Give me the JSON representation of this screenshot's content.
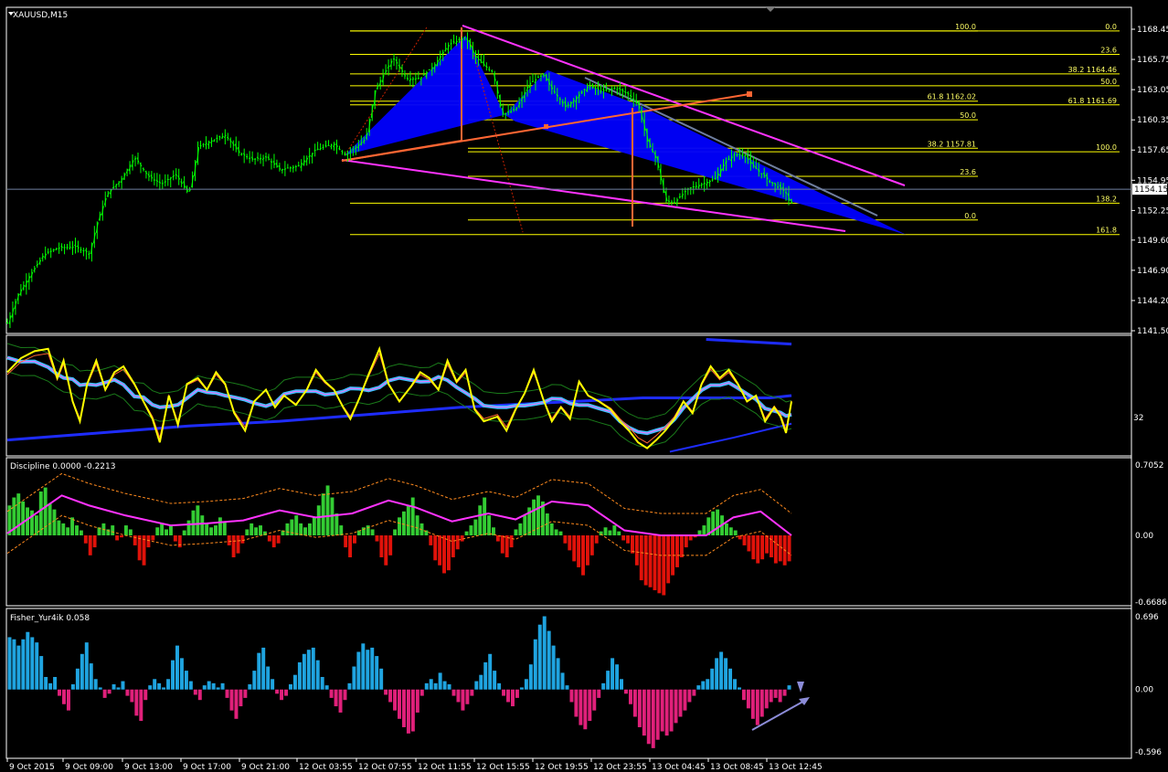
{
  "window": {
    "symbol_title": "XAUUSD,M15"
  },
  "colors": {
    "background": "#000000",
    "frame": "#ffffff",
    "candles": "#00ff00",
    "fib_levels": "#ffff00",
    "channel": "#ff33ff",
    "pattern_fill": "#0000ff",
    "trend_line": "#ff6633",
    "price_line": "#6f7fa0",
    "rsi": "#ffff00",
    "band": "#1e2cff",
    "histogram_up": "#33cc33",
    "histogram_down": "#e0120a",
    "signal": "#ff33ff",
    "fisher_up": "#1fa4e0",
    "fisher_down": "#e0207a",
    "arrow": "#8c8cd8"
  },
  "chart_data": [
    {
      "type": "candlestick",
      "panel": "main",
      "title": "XAUUSD,M15",
      "ylim": [
        1141.5,
        1168.45
      ],
      "y_ticks": [
        "1168.45",
        "1165.75",
        "1163.05",
        "1160.35",
        "1157.65",
        "1154.95",
        "1152.25",
        "1149.60",
        "1146.90",
        "1144.20",
        "1141.50"
      ],
      "current_price": "1154.15",
      "close_path": [
        [
          0,
          1142.2
        ],
        [
          12,
          1144.8
        ],
        [
          25,
          1146.5
        ],
        [
          40,
          1148.3
        ],
        [
          55,
          1148.9
        ],
        [
          75,
          1149.0
        ],
        [
          90,
          1148.4
        ],
        [
          100,
          1151.5
        ],
        [
          110,
          1153.8
        ],
        [
          125,
          1155.0
        ],
        [
          140,
          1157.0
        ],
        [
          155,
          1155.3
        ],
        [
          170,
          1154.6
        ],
        [
          185,
          1155.5
        ],
        [
          200,
          1153.7
        ],
        [
          210,
          1157.9
        ],
        [
          225,
          1158.5
        ],
        [
          240,
          1159.0
        ],
        [
          255,
          1157.4
        ],
        [
          270,
          1156.8
        ],
        [
          285,
          1157.0
        ],
        [
          300,
          1155.9
        ],
        [
          320,
          1156.2
        ],
        [
          340,
          1157.7
        ],
        [
          360,
          1158.2
        ],
        [
          372,
          1157.2
        ],
        [
          385,
          1158.0
        ],
        [
          395,
          1158.7
        ],
        [
          405,
          1163.0
        ],
        [
          415,
          1164.5
        ],
        [
          425,
          1165.9
        ],
        [
          440,
          1164.0
        ],
        [
          455,
          1164.1
        ],
        [
          470,
          1165.2
        ],
        [
          485,
          1167.0
        ],
        [
          495,
          1167.4
        ],
        [
          505,
          1167.7
        ],
        [
          515,
          1166.0
        ],
        [
          525,
          1165.2
        ],
        [
          535,
          1164.6
        ],
        [
          545,
          1160.8
        ],
        [
          560,
          1161.3
        ],
        [
          575,
          1163.6
        ],
        [
          590,
          1164.4
        ],
        [
          600,
          1163.1
        ],
        [
          615,
          1161.5
        ],
        [
          625,
          1162.2
        ],
        [
          640,
          1163.4
        ],
        [
          655,
          1162.9
        ],
        [
          670,
          1163.2
        ],
        [
          685,
          1162.6
        ],
        [
          695,
          1161.7
        ],
        [
          705,
          1158.4
        ],
        [
          715,
          1156.8
        ],
        [
          725,
          1153.1
        ],
        [
          735,
          1153.0
        ],
        [
          750,
          1154.2
        ],
        [
          765,
          1154.6
        ],
        [
          780,
          1155.1
        ],
        [
          790,
          1156.5
        ],
        [
          800,
          1157.2
        ],
        [
          812,
          1157.3
        ],
        [
          820,
          1156.3
        ],
        [
          830,
          1155.6
        ],
        [
          840,
          1154.8
        ],
        [
          850,
          1154.3
        ],
        [
          858,
          1153.8
        ],
        [
          862,
          1152.9
        ]
      ],
      "fibonacci": {
        "set_a": [
          {
            "label": "100.0",
            "price": 1168.3
          },
          {
            "label": "23.6",
            "price": 1166.2
          },
          {
            "label": "38.2 1164.46",
            "price": 1164.46
          },
          {
            "label": "50.0",
            "price": 1163.4
          },
          {
            "label": "61.8 1162.02",
            "price": 1162.02
          },
          {
            "label": "0.0",
            "price": 1168.3
          },
          {
            "label": "61.8 1161.69",
            "price": 1161.69
          },
          {
            "label": "138.2",
            "price": 1152.9
          },
          {
            "label": "161.8",
            "price": 1150.1
          }
        ],
        "set_b": [
          {
            "label": "50.0",
            "price": 1160.35
          },
          {
            "label": "38.2 1157.81",
            "price": 1157.81
          },
          {
            "label": "100.0",
            "price": 1157.5
          },
          {
            "label": "23.6",
            "price": 1155.3
          },
          {
            "label": "0.0",
            "price": 1151.4
          }
        ]
      }
    },
    {
      "type": "line",
      "panel": "rsi",
      "y_tick": "32",
      "series_yellow": [
        [
          0,
          0.3
        ],
        [
          15,
          0.18
        ],
        [
          30,
          0.12
        ],
        [
          45,
          0.1
        ],
        [
          55,
          0.35
        ],
        [
          62,
          0.2
        ],
        [
          72,
          0.55
        ],
        [
          80,
          0.72
        ],
        [
          88,
          0.4
        ],
        [
          98,
          0.2
        ],
        [
          108,
          0.45
        ],
        [
          118,
          0.3
        ],
        [
          128,
          0.25
        ],
        [
          140,
          0.4
        ],
        [
          150,
          0.55
        ],
        [
          160,
          0.7
        ],
        [
          168,
          0.9
        ],
        [
          178,
          0.5
        ],
        [
          188,
          0.75
        ],
        [
          198,
          0.4
        ],
        [
          210,
          0.35
        ],
        [
          220,
          0.45
        ],
        [
          230,
          0.3
        ],
        [
          240,
          0.4
        ],
        [
          250,
          0.65
        ],
        [
          262,
          0.8
        ],
        [
          272,
          0.55
        ],
        [
          285,
          0.45
        ],
        [
          295,
          0.6
        ],
        [
          305,
          0.5
        ],
        [
          318,
          0.58
        ],
        [
          330,
          0.45
        ],
        [
          340,
          0.28
        ],
        [
          350,
          0.38
        ],
        [
          360,
          0.45
        ],
        [
          370,
          0.6
        ],
        [
          378,
          0.7
        ],
        [
          388,
          0.52
        ],
        [
          398,
          0.32
        ],
        [
          410,
          0.1
        ],
        [
          420,
          0.4
        ],
        [
          432,
          0.55
        ],
        [
          445,
          0.42
        ],
        [
          455,
          0.3
        ],
        [
          465,
          0.35
        ],
        [
          475,
          0.45
        ],
        [
          485,
          0.2
        ],
        [
          495,
          0.38
        ],
        [
          505,
          0.28
        ],
        [
          515,
          0.62
        ],
        [
          525,
          0.72
        ],
        [
          540,
          0.68
        ],
        [
          550,
          0.8
        ],
        [
          560,
          0.62
        ],
        [
          570,
          0.48
        ],
        [
          580,
          0.28
        ],
        [
          590,
          0.52
        ],
        [
          600,
          0.72
        ],
        [
          610,
          0.6
        ],
        [
          620,
          0.7
        ],
        [
          630,
          0.38
        ],
        [
          640,
          0.5
        ],
        [
          652,
          0.55
        ],
        [
          665,
          0.62
        ],
        [
          675,
          0.72
        ],
        [
          685,
          0.8
        ],
        [
          695,
          0.9
        ],
        [
          705,
          0.95
        ],
        [
          715,
          0.88
        ],
        [
          725,
          0.8
        ],
        [
          735,
          0.7
        ],
        [
          745,
          0.55
        ],
        [
          755,
          0.65
        ],
        [
          765,
          0.4
        ],
        [
          775,
          0.25
        ],
        [
          785,
          0.35
        ],
        [
          795,
          0.28
        ],
        [
          805,
          0.4
        ],
        [
          815,
          0.55
        ],
        [
          825,
          0.5
        ],
        [
          835,
          0.72
        ],
        [
          845,
          0.6
        ],
        [
          852,
          0.68
        ],
        [
          858,
          0.82
        ],
        [
          864,
          0.55
        ]
      ],
      "series_band": [
        [
          0,
          0.88
        ],
        [
          100,
          0.82
        ],
        [
          200,
          0.76
        ],
        [
          300,
          0.72
        ],
        [
          400,
          0.66
        ],
        [
          500,
          0.6
        ],
        [
          600,
          0.56
        ],
        [
          700,
          0.52
        ],
        [
          760,
          0.52
        ],
        [
          800,
          0.52
        ],
        [
          840,
          0.52
        ],
        [
          864,
          0.5
        ]
      ],
      "series_band_top": [
        [
          770,
          0.02
        ],
        [
          864,
          0.06
        ]
      ],
      "series_band_bottom": [
        [
          730,
          0.98
        ],
        [
          800,
          0.86
        ],
        [
          864,
          0.74
        ]
      ]
    },
    {
      "type": "bar",
      "panel": "discipline",
      "title": "Discipline 0.0000 -0.2213",
      "ylim": [
        -0.6686,
        0.7052
      ],
      "y_ticks": [
        "0.7052",
        "0.00",
        "-0.6686"
      ],
      "values": [
        0.3,
        0.38,
        0.42,
        0.34,
        0.28,
        0.25,
        0.2,
        0.44,
        0.48,
        0.32,
        0.26,
        0.15,
        0.12,
        0.08,
        0.18,
        0.1,
        0.05,
        -0.08,
        -0.2,
        -0.12,
        0.08,
        0.12,
        0.06,
        0.1,
        -0.05,
        -0.02,
        0.1,
        0.06,
        -0.1,
        -0.25,
        -0.3,
        -0.12,
        -0.05,
        0.08,
        0.12,
        0.06,
        0.1,
        -0.06,
        -0.12,
        0.05,
        0.15,
        0.25,
        0.3,
        0.2,
        0.12,
        0.08,
        0.1,
        0.18,
        0.14,
        -0.1,
        -0.22,
        -0.18,
        -0.08,
        0.06,
        0.12,
        0.08,
        0.1,
        0.04,
        -0.06,
        -0.12,
        -0.08,
        0.05,
        0.12,
        0.16,
        0.2,
        0.12,
        0.08,
        0.12,
        0.18,
        0.3,
        0.42,
        0.5,
        0.38,
        0.22,
        0.1,
        -0.12,
        -0.22,
        -0.08,
        0.05,
        0.08,
        0.1,
        0.06,
        -0.06,
        -0.22,
        -0.3,
        -0.2,
        0.06,
        0.18,
        0.24,
        0.3,
        0.38,
        0.2,
        0.12,
        0.05,
        -0.1,
        -0.25,
        -0.3,
        -0.38,
        -0.35,
        -0.22,
        -0.14,
        -0.06,
        0.04,
        0.1,
        0.16,
        0.3,
        0.38,
        0.2,
        0.08,
        -0.06,
        -0.18,
        -0.22,
        -0.12,
        0.06,
        0.12,
        0.2,
        0.28,
        0.36,
        0.4,
        0.34,
        0.22,
        0.12,
        0.06,
        0.04,
        -0.08,
        -0.15,
        -0.26,
        -0.32,
        -0.4,
        -0.3,
        -0.2,
        -0.08,
        0.04,
        0.08,
        0.05,
        0.1,
        0.04,
        -0.05,
        -0.08,
        -0.18,
        -0.3,
        -0.45,
        -0.5,
        -0.52,
        -0.55,
        -0.58,
        -0.6,
        -0.48,
        -0.4,
        -0.32,
        -0.22,
        -0.12,
        -0.05,
        -0.02,
        0.05,
        0.1,
        0.18,
        0.24,
        0.26,
        0.2,
        0.12,
        0.08,
        0.05,
        -0.04,
        -0.1,
        -0.16,
        -0.24,
        -0.28,
        -0.24,
        -0.18,
        -0.22,
        -0.28,
        -0.26,
        -0.3,
        -0.26
      ],
      "signal": [
        [
          0,
          0.02
        ],
        [
          60,
          0.4
        ],
        [
          90,
          0.3
        ],
        [
          130,
          0.2
        ],
        [
          180,
          0.1
        ],
        [
          220,
          0.12
        ],
        [
          260,
          0.15
        ],
        [
          300,
          0.25
        ],
        [
          340,
          0.18
        ],
        [
          380,
          0.22
        ],
        [
          420,
          0.35
        ],
        [
          450,
          0.28
        ],
        [
          490,
          0.14
        ],
        [
          530,
          0.22
        ],
        [
          560,
          0.16
        ],
        [
          600,
          0.34
        ],
        [
          640,
          0.3
        ],
        [
          680,
          0.05
        ],
        [
          720,
          0.0
        ],
        [
          770,
          0.0
        ],
        [
          800,
          0.18
        ],
        [
          830,
          0.24
        ],
        [
          864,
          0.0
        ]
      ]
    },
    {
      "type": "bar",
      "panel": "fisher",
      "title": "Fisher_Yur4ik 0.058",
      "ylim": [
        -0.596,
        0.696
      ],
      "y_ticks": [
        "0.696",
        "0.00",
        "-0.596"
      ],
      "values": [
        0.5,
        0.48,
        0.42,
        0.48,
        0.55,
        0.5,
        0.45,
        0.32,
        0.12,
        0.06,
        0.12,
        -0.06,
        -0.14,
        -0.2,
        0.05,
        0.2,
        0.34,
        0.45,
        0.25,
        0.1,
        0.02,
        -0.08,
        -0.04,
        0.05,
        0.02,
        0.08,
        -0.06,
        -0.12,
        -0.25,
        -0.3,
        -0.1,
        0.04,
        0.1,
        0.06,
        0.02,
        0.1,
        0.28,
        0.42,
        0.3,
        0.18,
        0.08,
        -0.05,
        -0.1,
        0.04,
        0.08,
        0.06,
        0.02,
        0.06,
        -0.08,
        -0.2,
        -0.28,
        -0.16,
        -0.08,
        0.05,
        0.18,
        0.35,
        0.4,
        0.22,
        0.1,
        -0.04,
        -0.1,
        -0.06,
        0.05,
        0.14,
        0.26,
        0.34,
        0.38,
        0.4,
        0.28,
        0.12,
        0.04,
        -0.08,
        -0.16,
        -0.22,
        -0.1,
        0.06,
        0.22,
        0.36,
        0.44,
        0.38,
        0.4,
        0.32,
        0.2,
        -0.05,
        -0.12,
        -0.2,
        -0.28,
        -0.36,
        -0.42,
        -0.4,
        -0.22,
        -0.06,
        0.06,
        0.1,
        0.06,
        0.16,
        0.08,
        0.05,
        -0.06,
        -0.12,
        -0.2,
        -0.14,
        -0.06,
        0.08,
        0.14,
        0.26,
        0.34,
        0.18,
        0.06,
        -0.06,
        -0.12,
        -0.16,
        -0.08,
        0.02,
        0.1,
        0.24,
        0.48,
        0.62,
        0.7,
        0.56,
        0.42,
        0.3,
        0.16,
        0.04,
        -0.12,
        -0.26,
        -0.34,
        -0.38,
        -0.3,
        -0.2,
        -0.08,
        0.06,
        0.18,
        0.3,
        0.24,
        0.1,
        -0.04,
        -0.14,
        -0.26,
        -0.36,
        -0.44,
        -0.52,
        -0.56,
        -0.48,
        -0.4,
        -0.44,
        -0.4,
        -0.32,
        -0.26,
        -0.2,
        -0.12,
        -0.06,
        0.04,
        0.08,
        0.1,
        0.2,
        0.3,
        0.36,
        0.3,
        0.2,
        0.1,
        0.02,
        -0.1,
        -0.18,
        -0.28,
        -0.34,
        -0.26,
        -0.18,
        -0.12,
        -0.08,
        -0.12,
        -0.06,
        0.04
      ]
    }
  ],
  "time_axis": [
    "9 Oct 2015",
    "9 Oct 09:00",
    "9 Oct 13:00",
    "9 Oct 17:00",
    "9 Oct 21:00",
    "12 Oct 03:55",
    "12 Oct 07:55",
    "12 Oct 11:55",
    "12 Oct 15:55",
    "12 Oct 19:55",
    "12 Oct 23:55",
    "13 Oct 04:45",
    "13 Oct 08:45",
    "13 Oct 12:45"
  ]
}
